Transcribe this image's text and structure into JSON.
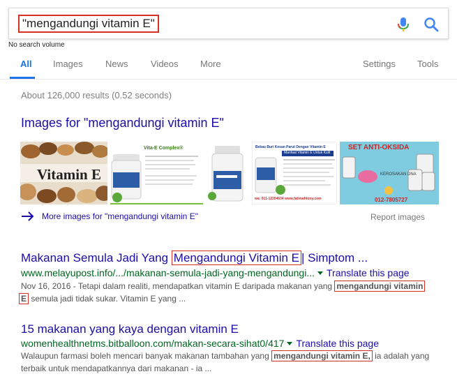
{
  "search": {
    "query": "\"mengandungi vitamin E\"",
    "volume_note": "No search volume"
  },
  "tabs": [
    {
      "label": "All"
    },
    {
      "label": "Images"
    },
    {
      "label": "News"
    },
    {
      "label": "Videos"
    },
    {
      "label": "More"
    },
    {
      "label": "Settings"
    },
    {
      "label": "Tools"
    }
  ],
  "stats": "About 126,000 results (0.52 seconds)",
  "images_block": {
    "heading": "Images for \"mengandungi vitamin E\"",
    "thumbnails": [
      {
        "caption": "Vitamin E"
      },
      {
        "caption": "Vita-E Complex"
      },
      {
        "caption": "Vita-E Complex bottle"
      },
      {
        "caption": "Bebas Buri Kesan Parut Dengan Vitamin E"
      },
      {
        "caption": "SET ANTI-OKSIDA"
      }
    ],
    "thumb_texts": {
      "t1_word": "Vitamin E",
      "t2_brand": "Vita-E Complex®",
      "t4_heading": "Bebas Buri Kesan Parut Dengan Vitamin E",
      "t4_sub": "Manfaat Vitamin E Untuk Kulit",
      "t4_footer": "wa: 011-12204634   www.fatimahtony.com",
      "t5_heading": "SET ANTI-OKSIDA",
      "t5_phone": "012-7805727",
      "t5_note": "KEROSAKAN DNA"
    },
    "more_link": "More images for \"mengandungi vitamin E\"",
    "report": "Report images"
  },
  "results": [
    {
      "title_pre": "Makanan Semula Jadi Yang ",
      "title_hl": "Mengandungi Vitamin E",
      "title_post": "| Simptom ...",
      "url": "www.melayupost.info/.../makanan-semula-jadi-yang-mengandungi...",
      "translate": "Translate this page",
      "line1_pre": "Nov 16, 2016 - Tetapi dalam realiti, mendapatkan vitamin E daripada makanan yang ",
      "line1_hl": "mengandungi vitamin",
      "line2_hl": "E",
      "line2_post": " semula jadi tidak sukar. Vitamin E yang ..."
    },
    {
      "title": "15 makanan yang kaya dengan vitamin E",
      "url": "womenhealthnetms.bitballoon.com/makan-secara-sihat0/417",
      "translate": "Translate this page",
      "line1_pre": "Walaupun farmasi boleh mencari banyak makanan tambahan yang ",
      "line1_hl": "mengandungi vitamin E,",
      "line1_post": " ia adalah yang",
      "line2": "terbaik untuk mendapatkannya dari makanan - ia ..."
    }
  ],
  "colors": {
    "link": "#1a0dab",
    "url_green": "#006621",
    "accent_blue": "#1a73e8",
    "annotation_red": "#d93025"
  }
}
